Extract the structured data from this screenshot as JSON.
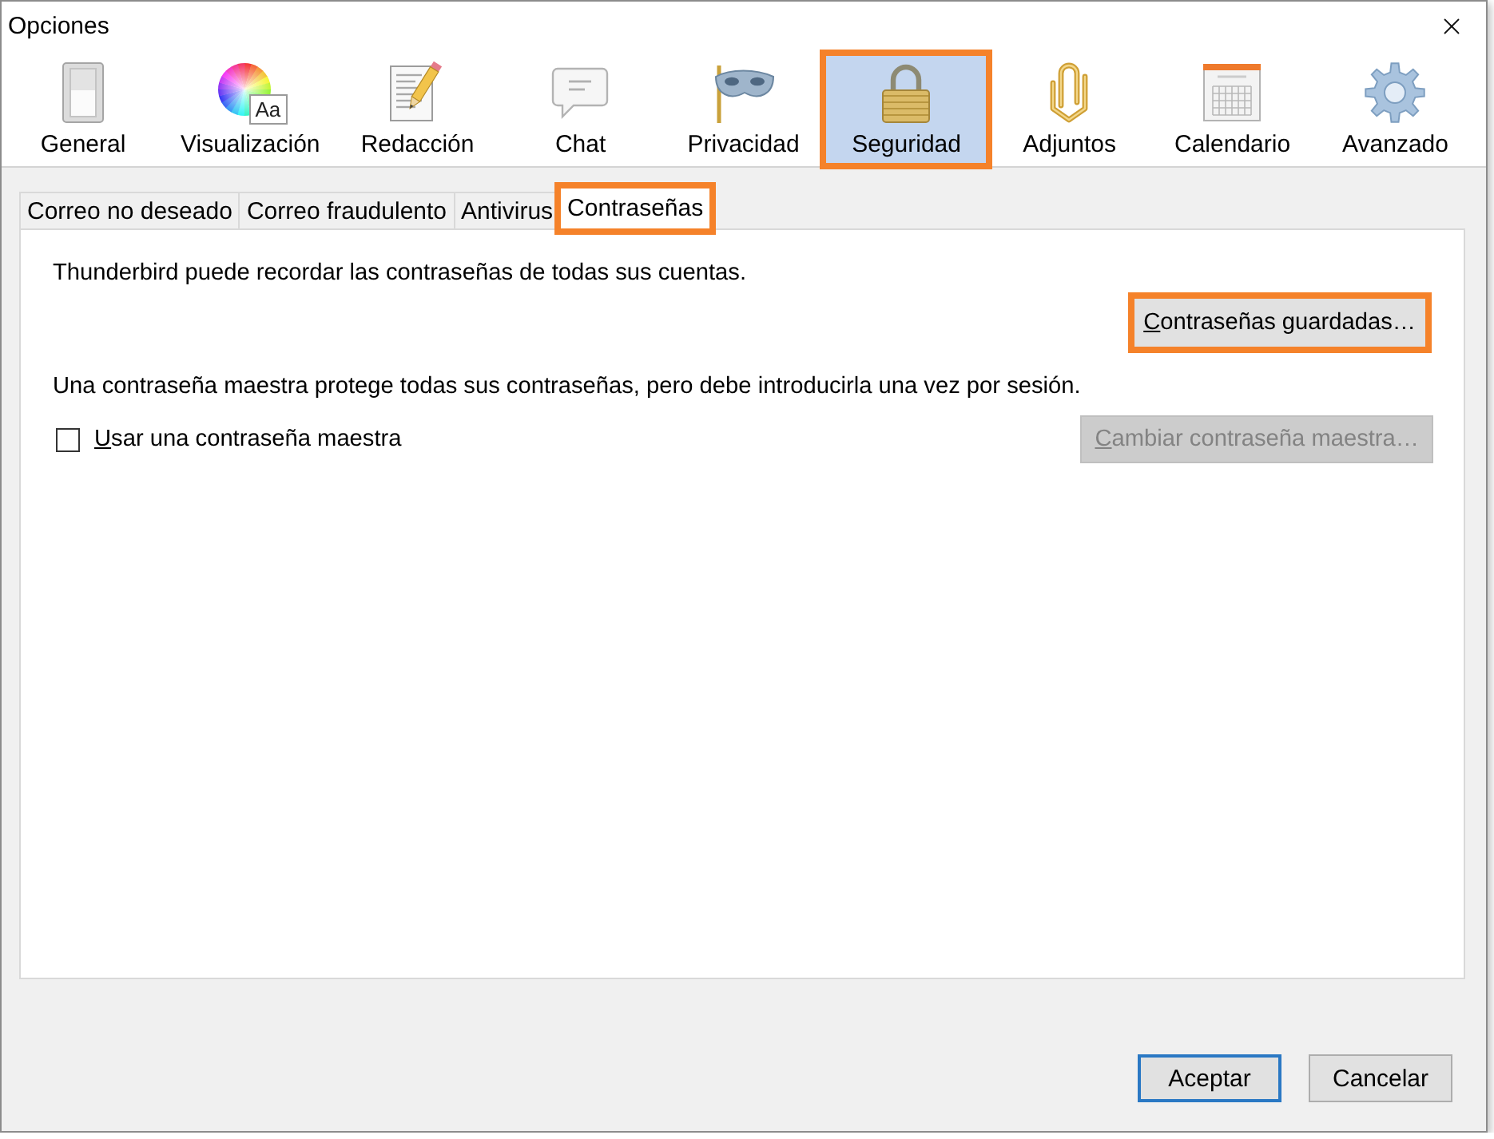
{
  "window": {
    "title": "Opciones"
  },
  "panes": [
    {
      "label": "General",
      "selected": false,
      "highlighted": false
    },
    {
      "label": "Visualización",
      "icon_badge": "Aa",
      "selected": false,
      "highlighted": false
    },
    {
      "label": "Redacción",
      "selected": false,
      "highlighted": false
    },
    {
      "label": "Chat",
      "selected": false,
      "highlighted": false
    },
    {
      "label": "Privacidad",
      "selected": false,
      "highlighted": false
    },
    {
      "label": "Seguridad",
      "selected": true,
      "highlighted": true
    },
    {
      "label": "Adjuntos",
      "selected": false,
      "highlighted": false
    },
    {
      "label": "Calendario",
      "selected": false,
      "highlighted": false
    },
    {
      "label": "Avanzado",
      "selected": false,
      "highlighted": false
    }
  ],
  "tabs": [
    {
      "label": "Correo no deseado",
      "selected": false,
      "highlighted": false
    },
    {
      "label": "Correo fraudulento",
      "selected": false,
      "highlighted": false
    },
    {
      "label": "Antivirus",
      "selected": false,
      "highlighted": false
    },
    {
      "label": "Contraseñas",
      "selected": true,
      "highlighted": true
    }
  ],
  "panel": {
    "description": "Thunderbird puede recordar las contraseñas de todas sus cuentas.",
    "saved_passwords_button": {
      "label": "Contraseñas guardadas…",
      "mnemonic_underlined": true,
      "highlighted": true
    },
    "master_password_note": "Una contraseña maestra protege todas sus contraseñas, pero debe introducirla una vez por sesión.",
    "master_password_checkbox": {
      "label": "Usar una contraseña maestra",
      "checked": false,
      "mnemonic_underlined": true
    },
    "change_master_button": {
      "label": "Cambiar contraseña maestra…",
      "disabled": true,
      "mnemonic_underlined": true
    }
  },
  "buttons": [
    {
      "label": "Aceptar",
      "default": true
    },
    {
      "label": "Cancelar",
      "default": false
    }
  ]
}
